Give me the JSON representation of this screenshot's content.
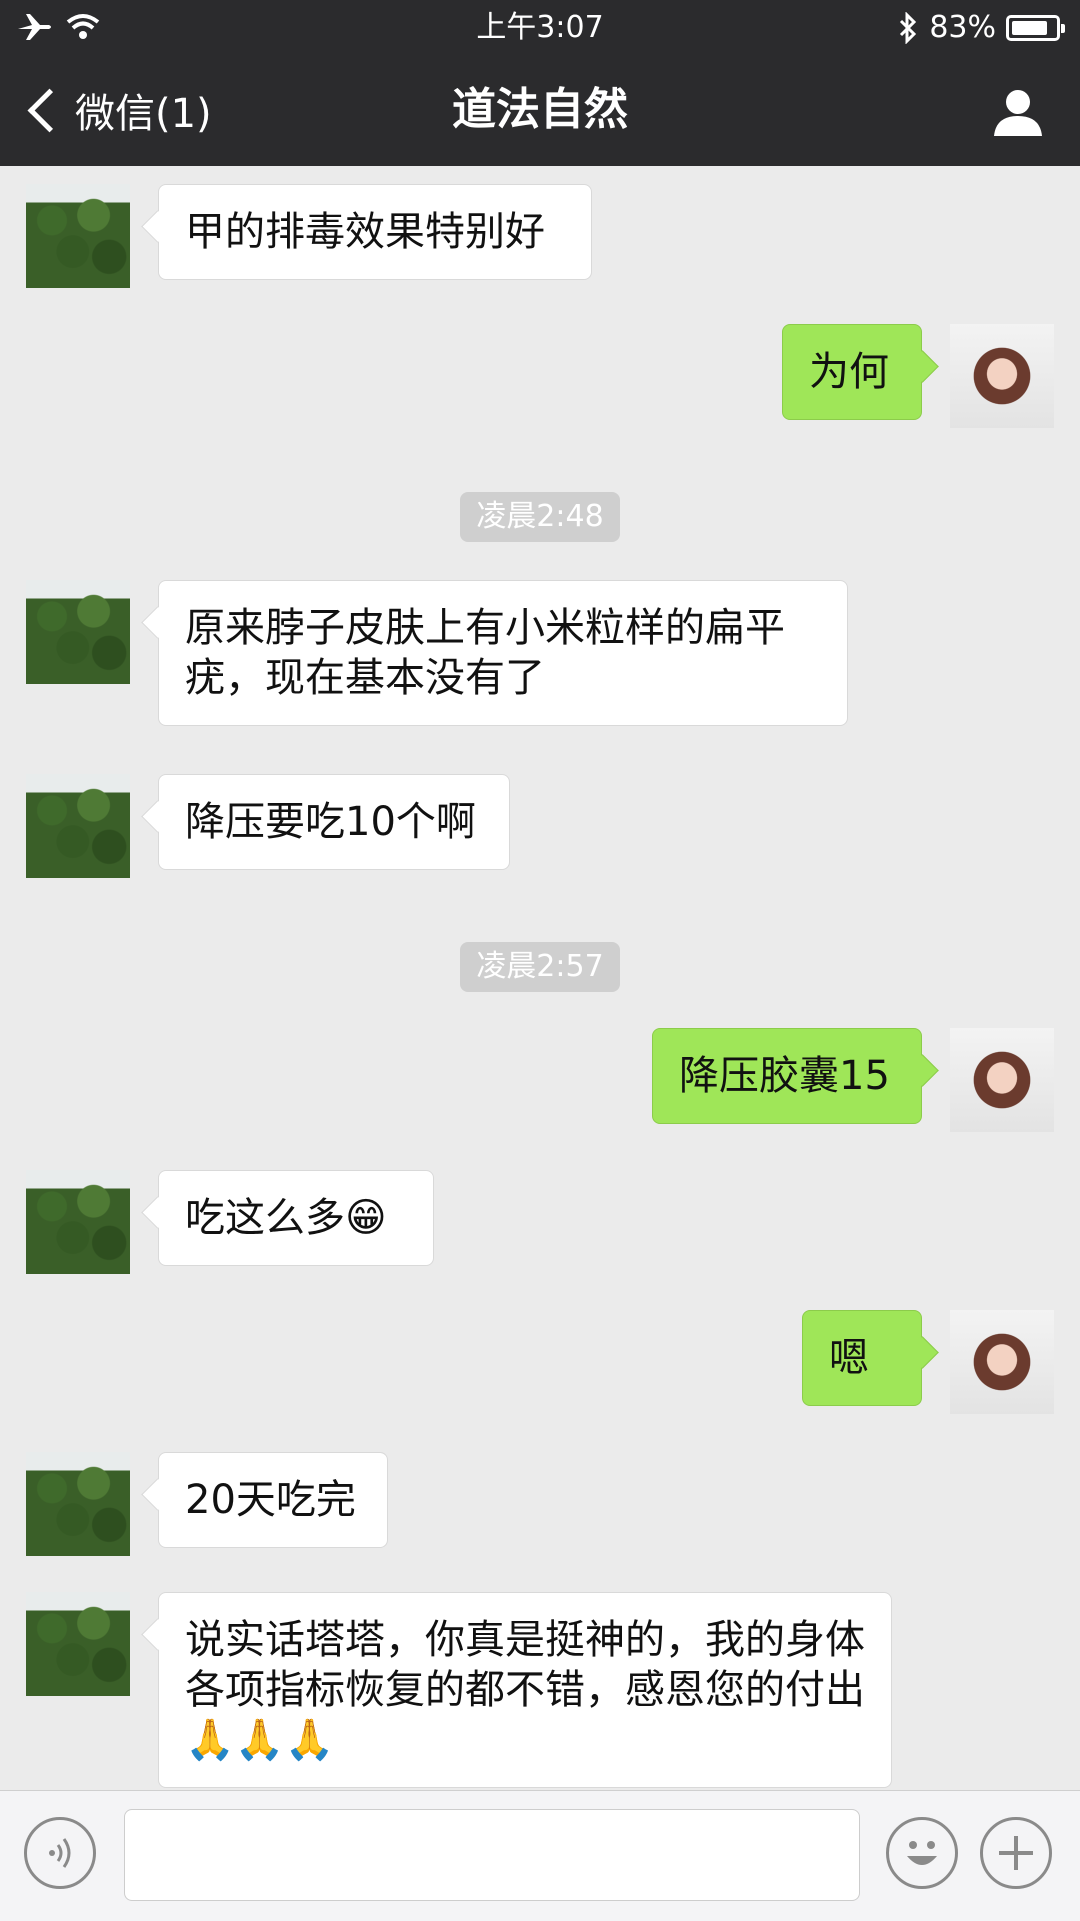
{
  "status_bar": {
    "time": "上午3:07",
    "battery_text": "83%",
    "battery_level": 0.83
  },
  "nav": {
    "back_label": "微信(1)",
    "title": "道法自然"
  },
  "messages": [
    {
      "type": "in",
      "text": "甲的排毒效果特别好"
    },
    {
      "type": "out",
      "text": "为何"
    },
    {
      "type": "time",
      "text": "凌晨2:48"
    },
    {
      "type": "in",
      "text": "原来脖子皮肤上有小米粒样的扁平疣，现在基本没有了"
    },
    {
      "type": "in",
      "text": "降压要吃10个啊"
    },
    {
      "type": "time",
      "text": "凌晨2:57"
    },
    {
      "type": "out",
      "text": "降压胶囊15"
    },
    {
      "type": "in",
      "text": "吃这么多😁"
    },
    {
      "type": "out",
      "text": "嗯"
    },
    {
      "type": "in",
      "text": "20天吃完"
    },
    {
      "type": "in",
      "text": "说实话塔塔，你真是挺神的，我的身体各项指标恢复的都不错，感恩您的付出🙏🙏🙏"
    }
  ],
  "input": {
    "value": "",
    "placeholder": ""
  },
  "icons": {
    "voice": "voice-icon",
    "emoji": "emoji-icon",
    "plus": "plus-icon",
    "profile": "profile-icon",
    "back": "chevron-left-icon"
  }
}
